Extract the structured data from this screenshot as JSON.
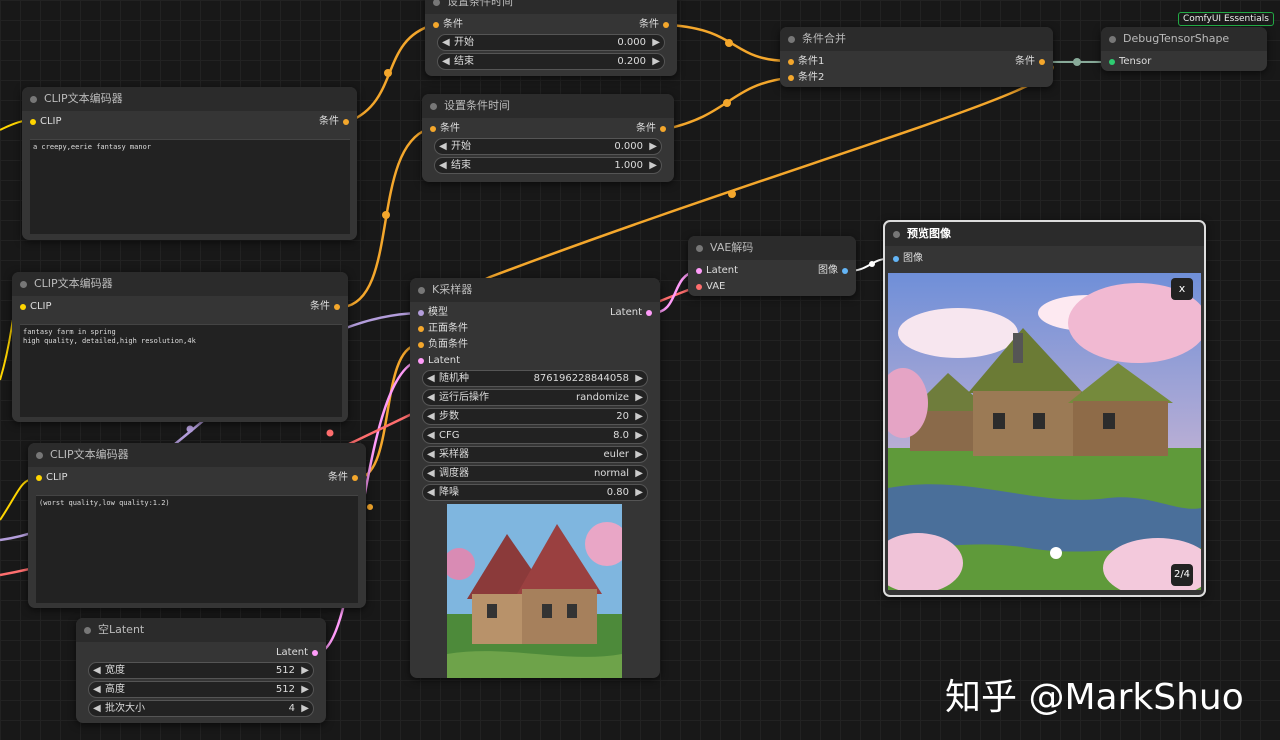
{
  "badge": "ComfyUI Essentials",
  "watermark": "知乎 @MarkShuo",
  "colors": {
    "conditioning": "#f4a72c",
    "clip": "#ffd500",
    "latent": "#ff9cf9",
    "model": "#b39ddb",
    "vae": "#ff6e6e",
    "image": "#64b5f6",
    "tensor": "#2ecc71"
  },
  "nodes": {
    "timestep_a": {
      "title": "设置条件时间",
      "in_label": "条件",
      "out_label": "条件",
      "start_name": "开始",
      "start_val": "0.000",
      "end_name": "结束",
      "end_val": "0.200"
    },
    "timestep_b": {
      "title": "设置条件时间",
      "in_label": "条件",
      "out_label": "条件",
      "start_name": "开始",
      "start_val": "0.000",
      "end_name": "结束",
      "end_val": "1.000"
    },
    "clip1": {
      "title": "CLIP文本编码器",
      "in_label": "CLIP",
      "out_label": "条件",
      "text": "a creepy,eerie fantasy manor"
    },
    "clip2": {
      "title": "CLIP文本编码器",
      "in_label": "CLIP",
      "out_label": "条件",
      "text": "fantasy farm in spring\nhigh quality, detailed,high resolution,4k"
    },
    "clip3": {
      "title": "CLIP文本编码器",
      "in_label": "CLIP",
      "out_label": "条件",
      "text": "(worst quality,low quality:1.2)"
    },
    "combine": {
      "title": "条件合并",
      "in1": "条件1",
      "in2": "条件2",
      "out_label": "条件"
    },
    "debug": {
      "title": "DebugTensorShape",
      "in_label": "Tensor"
    },
    "vae": {
      "title": "VAE解码",
      "in_latent": "Latent",
      "in_vae": "VAE",
      "out_label": "图像"
    },
    "preview": {
      "title": "预览图像",
      "in_label": "图像",
      "close": "x",
      "pager": "2/4"
    },
    "ksampler": {
      "title": "K采样器",
      "inputs": [
        "模型",
        "正面条件",
        "负面条件",
        "Latent"
      ],
      "out_label": "Latent",
      "widgets": [
        {
          "name": "随机种",
          "value": "876196228844058"
        },
        {
          "name": "运行后操作",
          "value": "randomize"
        },
        {
          "name": "步数",
          "value": "20"
        },
        {
          "name": "CFG",
          "value": "8.0"
        },
        {
          "name": "采样器",
          "value": "euler"
        },
        {
          "name": "调度器",
          "value": "normal"
        },
        {
          "name": "降噪",
          "value": "0.80"
        }
      ]
    },
    "empty_latent": {
      "title": "空Latent",
      "out_label": "Latent",
      "widgets": [
        {
          "name": "宽度",
          "value": "512"
        },
        {
          "name": "高度",
          "value": "512"
        },
        {
          "name": "批次大小",
          "value": "4"
        }
      ]
    }
  }
}
